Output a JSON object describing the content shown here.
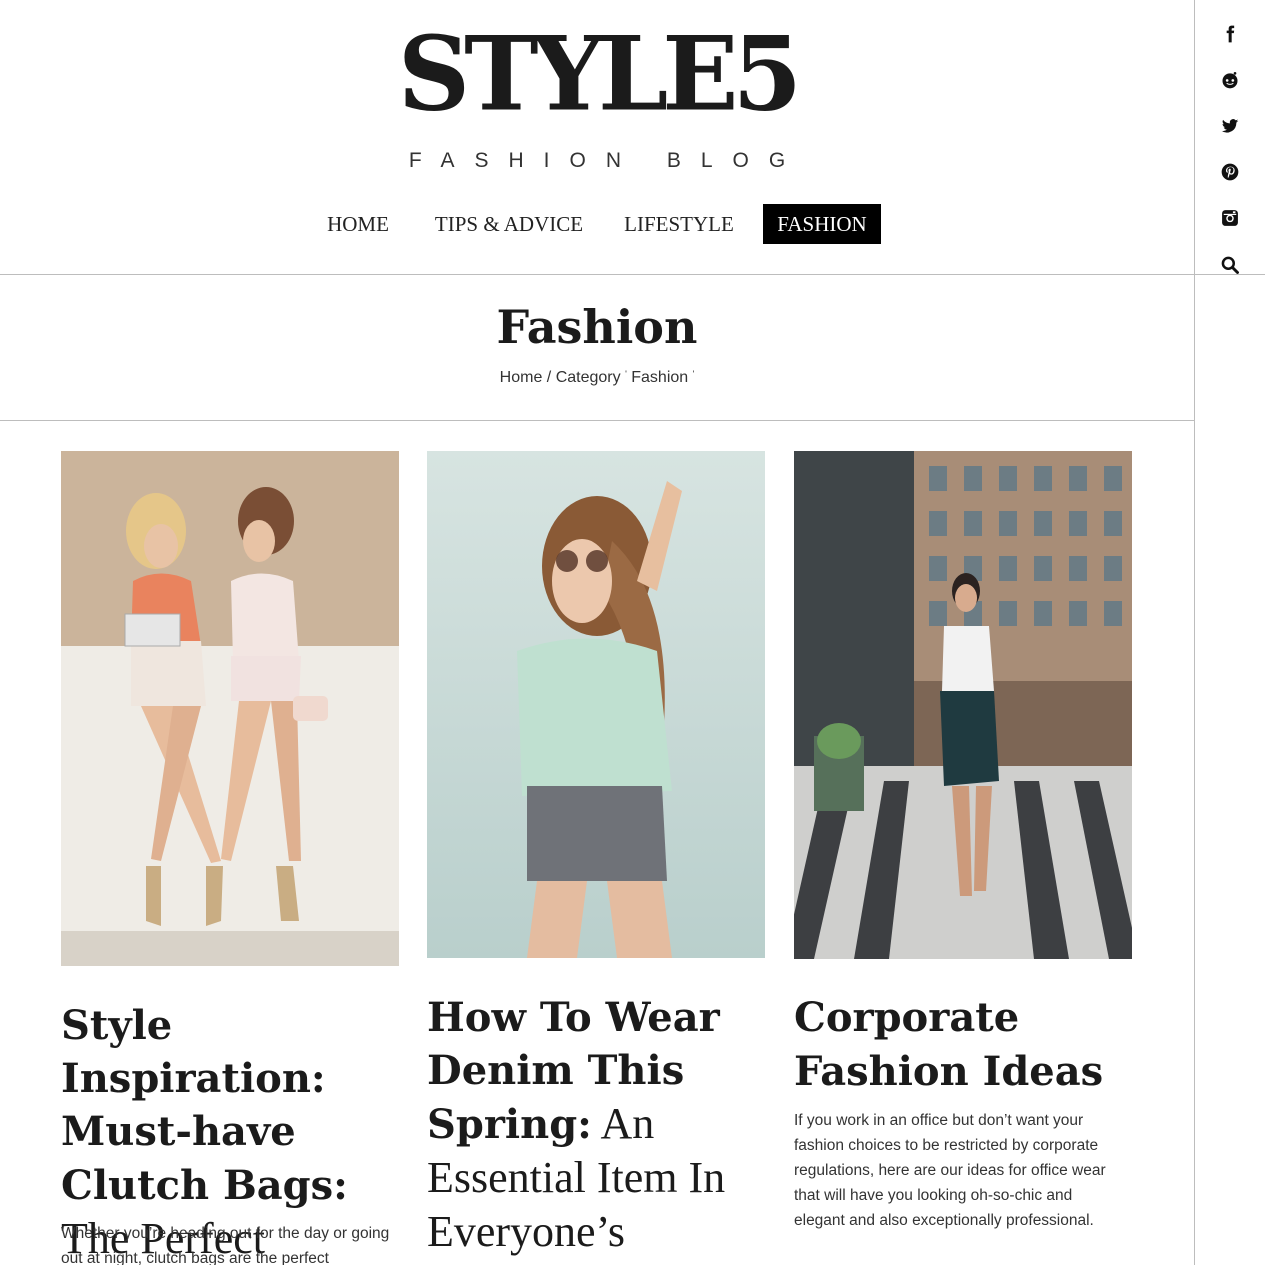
{
  "site": {
    "logo": "STYLE5",
    "tagline": "FASHION BLOG"
  },
  "nav": {
    "items": [
      {
        "label": "HOME",
        "active": false
      },
      {
        "label": "TIPS & ADVICE",
        "active": false
      },
      {
        "label": "LIFESTYLE",
        "active": false
      },
      {
        "label": "FASHION",
        "active": true
      }
    ]
  },
  "social": [
    "facebook-icon",
    "reddit-icon",
    "twitter-icon",
    "pinterest-icon",
    "instagram-icon",
    "search-icon"
  ],
  "page": {
    "title": "Fashion",
    "breadcrumb": {
      "home": "Home",
      "sep": "/",
      "category": "Category",
      "current": "Fashion"
    }
  },
  "posts": [
    {
      "title_bold": "Style Inspiration: Must-have Clutch Bags:",
      "title_rest": " The Perfect Accessory",
      "excerpt": "Whether you’re heading out for the day or going out at night, clutch bags are the perfect"
    },
    {
      "title_bold": "How To Wear Denim This Spring:",
      "title_rest": " An Essential Item In Everyone’s",
      "excerpt": ""
    },
    {
      "title_bold": "Corporate Fashion Ideas",
      "title_rest": "",
      "excerpt": "If you work in an office but don’t want your fashion choices to be restricted by corporate regulations, here are our ideas for office wear that will have you looking oh-so-chic and elegant and also exceptionally professional."
    }
  ],
  "colors": {
    "text": "#1b1b1b",
    "nav_active_bg": "#000000",
    "divider": "#bdbdbd"
  }
}
